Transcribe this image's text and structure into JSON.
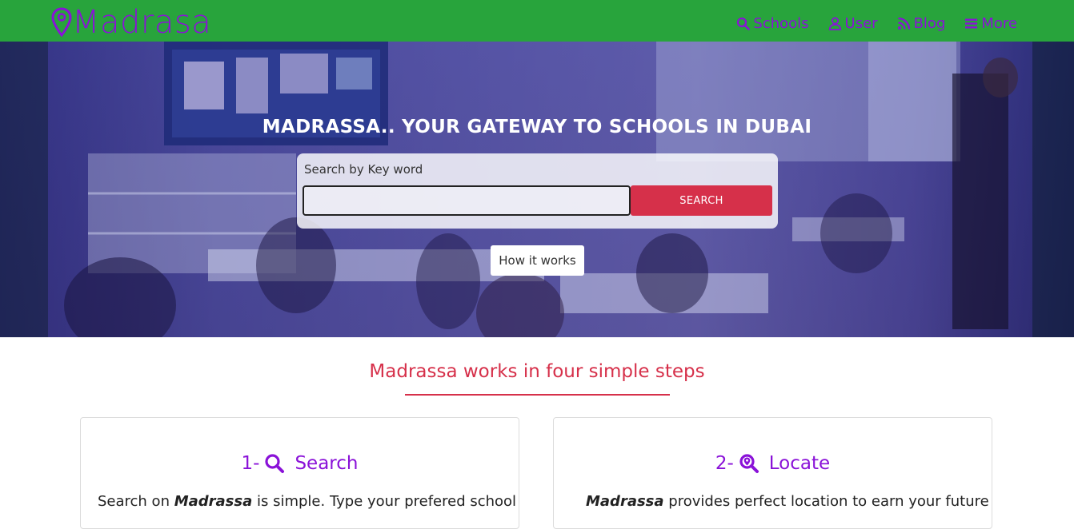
{
  "brand": {
    "name": "Madrasa",
    "icon": "map-pin-icon"
  },
  "nav": [
    {
      "label": "Schools",
      "icon": "search-icon"
    },
    {
      "label": "User",
      "icon": "user-icon"
    },
    {
      "label": "Blog",
      "icon": "rss-icon"
    },
    {
      "label": "More",
      "icon": "menu-icon"
    }
  ],
  "hero": {
    "title": "MADRASSA.. YOUR GATEWAY TO SCHOOLS IN DUBAI",
    "search_label": "Search by Key word",
    "search_value": "",
    "search_button": "SEARCH",
    "how_button": "How it works"
  },
  "steps": {
    "heading": "Madrassa works in four simple steps",
    "cards": [
      {
        "number": "1-",
        "title": "Search",
        "icon": "search-icon",
        "text_before": "Search on ",
        "brand": "Madrassa",
        "text_after": " is simple. Type your prefered school in"
      },
      {
        "number": "2-",
        "title": "Locate",
        "icon": "map-search-icon",
        "text_before": "",
        "brand": "Madrassa",
        "text_after": " provides perfect location to earn your future"
      }
    ]
  },
  "colors": {
    "navbar": "#28a43c",
    "brand": "#8a12d8",
    "accent": "#d6304a"
  }
}
